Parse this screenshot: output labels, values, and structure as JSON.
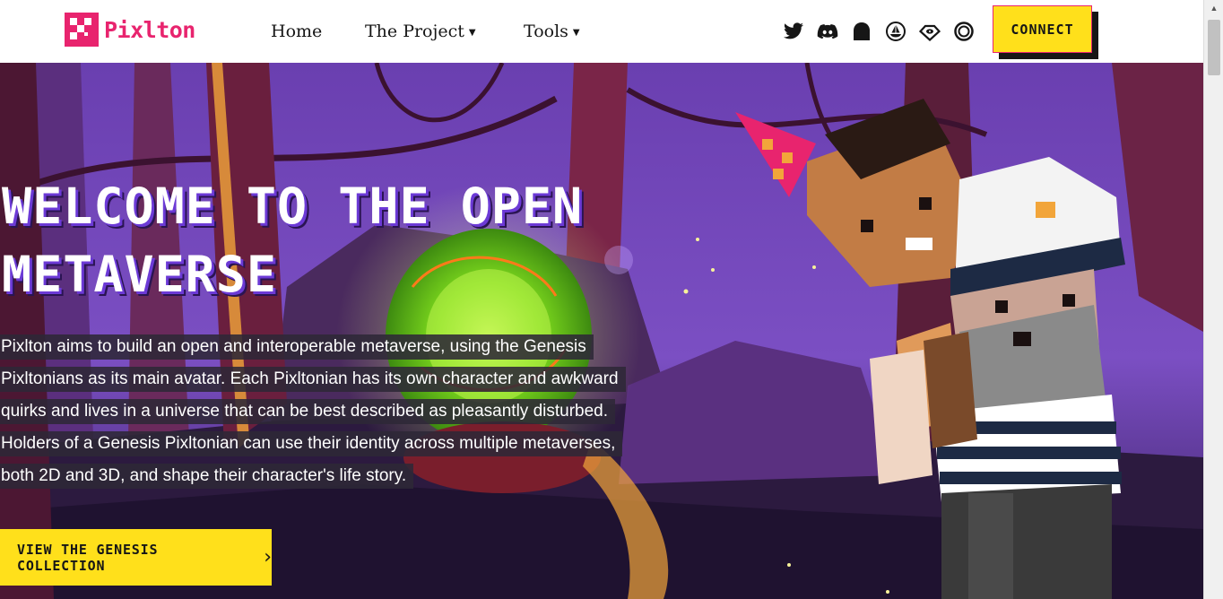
{
  "header": {
    "logo_text": "Pixlton",
    "nav": {
      "home": "Home",
      "project": "The Project",
      "tools": "Tools"
    },
    "socials": [
      "twitter-icon",
      "discord-icon",
      "ghost-icon",
      "opensea-icon",
      "looksrare-icon",
      "circle-icon"
    ],
    "connect_label": "CONNECT"
  },
  "hero": {
    "title": "WELCOME TO THE OPEN METAVERSE",
    "description_lines": [
      "Pixlton aims to build an open and interoperable metaverse, using the Genesis",
      "Pixltonians as its main avatar. Each Pixltonian has its own character and awkward",
      "quirks and lives in a universe that can be best described as pleasantly disturbed.",
      "Holders of a Genesis Pixltonian can use their identity across multiple metaverses,",
      "both 2D and 3D, and shape their character's life story."
    ],
    "cta_label": "VIEW THE GENESIS COLLECTION",
    "cta_arrow": "›"
  },
  "colors": {
    "brand_pink": "#e8246e",
    "accent_yellow": "#ffe01b",
    "hero_purple": "#4b2a86",
    "text_dark": "#161616"
  }
}
